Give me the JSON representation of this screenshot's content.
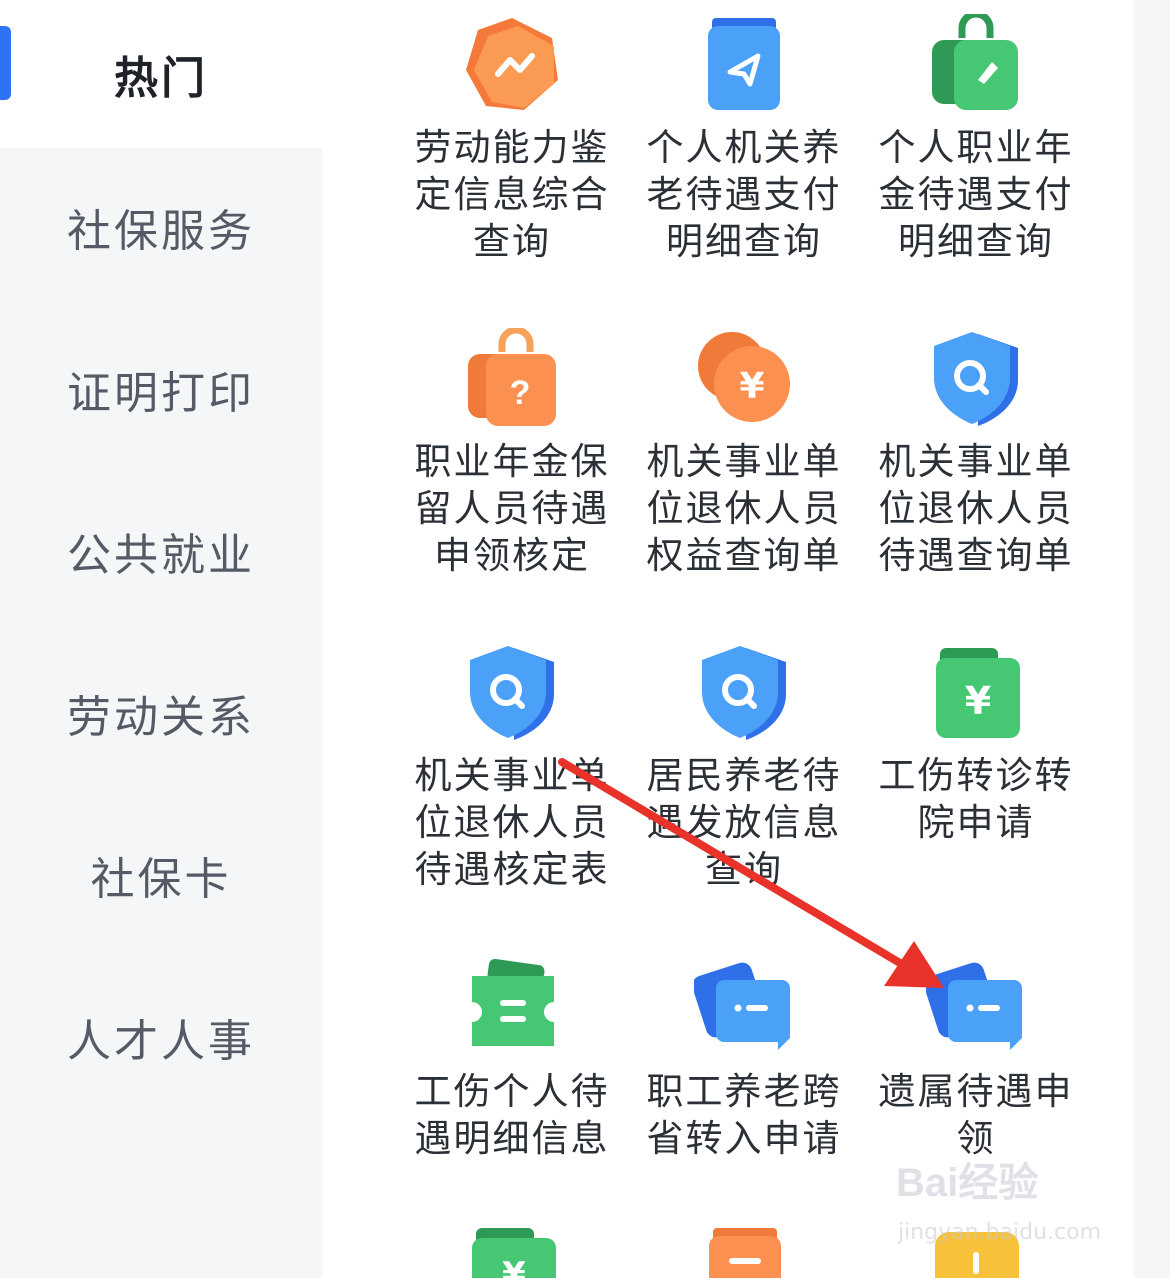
{
  "sidebar": {
    "items": [
      {
        "label": "热门",
        "active": true
      },
      {
        "label": "社保服务"
      },
      {
        "label": "证明打印"
      },
      {
        "label": "公共就业"
      },
      {
        "label": "劳动关系"
      },
      {
        "label": "社保卡"
      },
      {
        "label": "人才人事"
      }
    ],
    "accent_color": "#2e72f6"
  },
  "services": [
    {
      "label": "劳动能力鉴定信息综合查询",
      "icon": "hexagon-trend-icon",
      "color": "#f5793a"
    },
    {
      "label": "个人机关养老待遇支付明细查询",
      "icon": "book-send-icon",
      "color": "#3f8cf5"
    },
    {
      "label": "个人职业年金待遇支付明细查询",
      "icon": "bag-tag-icon",
      "color": "#3cbd6a"
    },
    {
      "label": "职业年金保留人员待遇申领核定",
      "icon": "bag-question-icon",
      "color": "#f5793a"
    },
    {
      "label": "机关事业单位退休人员权益查询单",
      "icon": "coin-yuan-icon",
      "color": "#f5793a"
    },
    {
      "label": "机关事业单位退休人员待遇查询单",
      "icon": "shield-search-icon",
      "color": "#3f8cf5"
    },
    {
      "label": "机关事业单位退休人员待遇核定表",
      "icon": "shield-search-icon",
      "color": "#3f8cf5"
    },
    {
      "label": "居民养老待遇发放信息查询",
      "icon": "shield-search-icon",
      "color": "#3f8cf5"
    },
    {
      "label": "工伤转诊转院申请",
      "icon": "wallet-yuan-icon",
      "color": "#3cbd6a"
    },
    {
      "label": "工伤个人待遇明细信息",
      "icon": "ticket-icon",
      "color": "#3cbd6a"
    },
    {
      "label": "职工养老跨省转入申请",
      "icon": "chat-card-icon",
      "color": "#3f8cf5"
    },
    {
      "label": "遗属待遇申领",
      "icon": "chat-card-icon",
      "color": "#3f8cf5"
    }
  ],
  "watermark": {
    "logo": "Bai经验",
    "url": "jingyan.baidu.com"
  },
  "annotation_arrow_color": "#e8322a"
}
